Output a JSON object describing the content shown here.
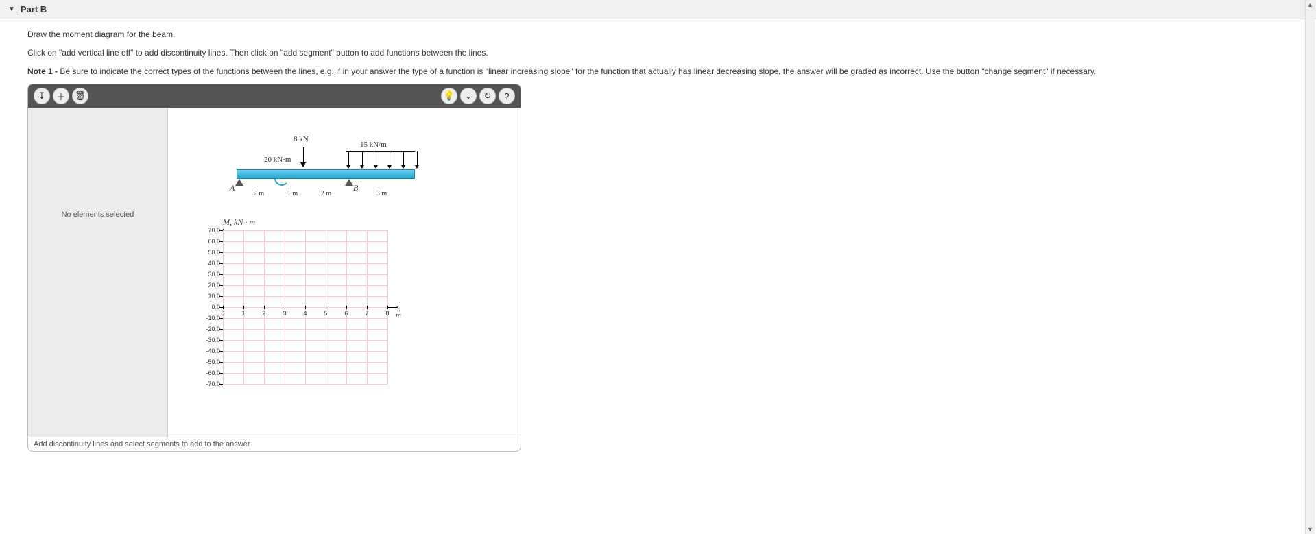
{
  "part": {
    "label": "Part B"
  },
  "instructions": {
    "line1": "Draw the moment diagram for the beam.",
    "line2": "Click on \"add vertical line off\" to add discontinuity lines. Then click on \"add segment\" button to add functions between the lines.",
    "note_prefix": "Note 1 - ",
    "note_body": "Be sure to indicate the correct types of the functions between the lines, e.g. if in your answer the type of a function is \"linear increasing slope\" for the function that actually has linear decreasing slope, the answer will be graded as incorrect. Use the button \"change segment\" if necessary."
  },
  "toolbar": {
    "add_line_icon": "↧",
    "add_segment_icon": "＋",
    "delete_icon": "🗑",
    "hint_icon": "💡",
    "more_icon": "⌄",
    "reset_icon": "↻",
    "help_icon": "?"
  },
  "selection": {
    "empty_text": "No elements selected"
  },
  "beam": {
    "point_load_label": "8 kN",
    "moment_label": "20 kN·m",
    "dist_load_label": "15 kN/m",
    "support_a": "A",
    "support_b": "B",
    "dims": {
      "d1": "2 m",
      "d2": "1 m",
      "d3": "2 m",
      "d4": "3 m"
    }
  },
  "chart_data": {
    "type": "line",
    "title": "M, kN · m",
    "xlabel": "x, m",
    "ylabel": "",
    "x_ticks": [
      0,
      1,
      2,
      3,
      4,
      5,
      6,
      7,
      8
    ],
    "y_ticks": [
      70.0,
      60.0,
      50.0,
      40.0,
      30.0,
      20.0,
      10.0,
      0.0,
      -10.0,
      -20.0,
      -30.0,
      -40.0,
      -50.0,
      -60.0,
      -70.0
    ],
    "xlim": [
      0,
      8
    ],
    "ylim": [
      -70,
      70
    ],
    "series": []
  },
  "footer": {
    "hint": "Add discontinuity lines and select segments to add to the answer"
  }
}
